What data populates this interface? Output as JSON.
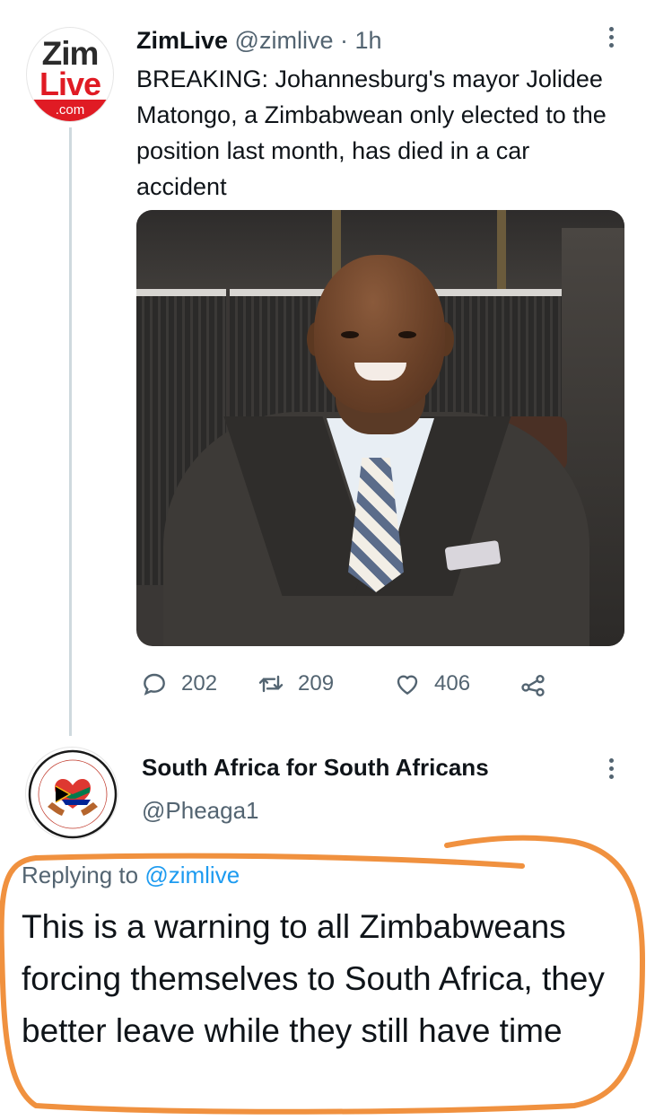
{
  "tweet1": {
    "avatar": {
      "line1": "Zim",
      "line2": "Live",
      "line3": ".com"
    },
    "name": "ZimLive",
    "handle": "@zimlive",
    "separator": " · ",
    "time": "1h",
    "text": "BREAKING: Johannesburg's mayor Jolidee Matongo, a Zimbabwean only elected to the position last month, has died in a car accident",
    "replies": "202",
    "retweets": "209",
    "likes": "406"
  },
  "tweet2": {
    "name": "South Africa for South Africans",
    "handle": "@Pheaga1",
    "replying_prefix": "Replying to ",
    "replying_to": "@zimlive",
    "text": "This is a warning to all Zimbabweans forcing themselves to South Africa, they better leave while they still have time"
  },
  "colors": {
    "text": "#0f1419",
    "secondary": "#536471",
    "link": "#1d9bf0",
    "annotation": "#f0913f"
  },
  "icons": [
    "reply-icon",
    "retweet-icon",
    "like-icon",
    "share-icon",
    "more-icon"
  ]
}
